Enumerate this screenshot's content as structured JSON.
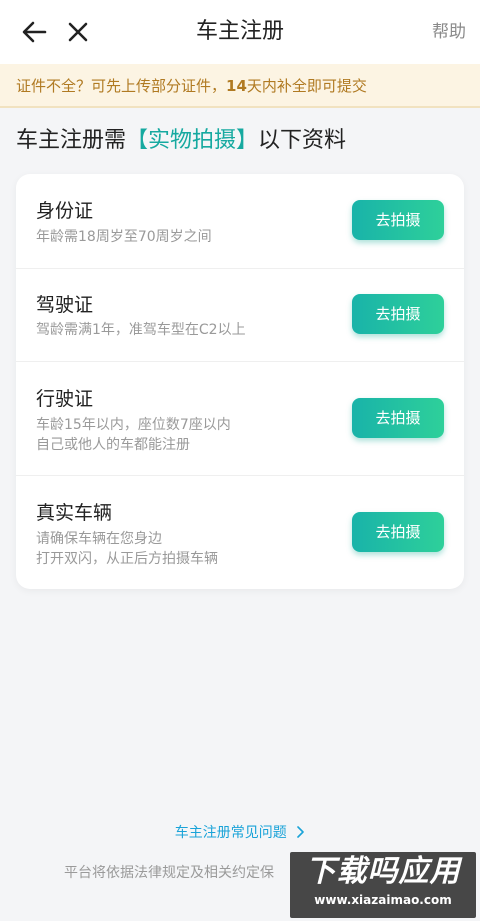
{
  "header": {
    "title": "车主注册",
    "help_label": "帮助"
  },
  "notice": {
    "text_before": "证件不全？可先上传部分证件，",
    "highlight": "14",
    "text_after": "天内补全即可提交"
  },
  "heading": {
    "prefix": "车主注册需",
    "highlight": "【实物拍摄】",
    "suffix": "以下资料"
  },
  "items": [
    {
      "title": "身份证",
      "desc": [
        "年龄需18周岁至70周岁之间"
      ],
      "button": "去拍摄"
    },
    {
      "title": "驾驶证",
      "desc": [
        "驾龄需满1年，准驾车型在C2以上"
      ],
      "button": "去拍摄"
    },
    {
      "title": "行驶证",
      "desc": [
        "车龄15年以内，座位数7座以内",
        "自己或他人的车都能注册"
      ],
      "button": "去拍摄"
    },
    {
      "title": "真实车辆",
      "desc": [
        "请确保车辆在您身边",
        "打开双闪，从正后方拍摄车辆"
      ],
      "button": "去拍摄"
    }
  ],
  "faq_link": "车主注册常见问题",
  "footer_text": "平台将依据法律规定及相关约定保",
  "watermark": {
    "line1": "下载吗应用",
    "line2": "www.xiazaimao.com"
  },
  "colors": {
    "accent": "#16a9a0",
    "button_gradient_start": "#19b3a9",
    "button_gradient_end": "#2ed09a",
    "notice_bg": "#fcf4e3",
    "notice_text": "#b07a22",
    "link": "#1aa3d8"
  },
  "icons": {
    "back": "arrow-left-icon",
    "close": "close-icon",
    "chevron": "chevron-right-icon"
  }
}
